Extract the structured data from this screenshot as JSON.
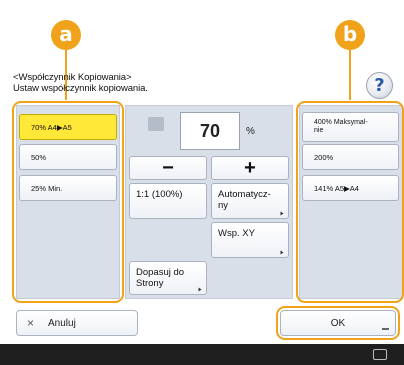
{
  "callouts": {
    "a": "a",
    "b": "b"
  },
  "header": {
    "line1": "<Współczynnik Kopiowania>",
    "line2": "Ustaw współczynnik kopiowania.",
    "help_glyph": "?"
  },
  "reduce_panel": {
    "items": [
      {
        "label": "70% A4▶A5",
        "selected": true
      },
      {
        "label": "50%",
        "selected": false
      },
      {
        "label": "25% Min.",
        "selected": false
      }
    ]
  },
  "center_panel": {
    "value": "70",
    "unit": "%",
    "minus_label": "−",
    "plus_label": "+",
    "one_to_one_label": "1:1 (100%)",
    "auto_label": "Automatycz-\nny",
    "xy_label": "Wsp. XY",
    "fit_label": "Dopasuj do\nStrony"
  },
  "enlarge_panel": {
    "items": [
      {
        "label": "400% Maksymal-\nnie"
      },
      {
        "label": "200%"
      },
      {
        "label": "141% A5▶A4"
      }
    ]
  },
  "footer": {
    "cancel_label": "Anuluj",
    "cancel_icon": "×",
    "ok_label": "OK"
  },
  "colors": {
    "accent": "#f0a21a",
    "selected": "#ffe838",
    "panel": "#d9dfe9"
  }
}
